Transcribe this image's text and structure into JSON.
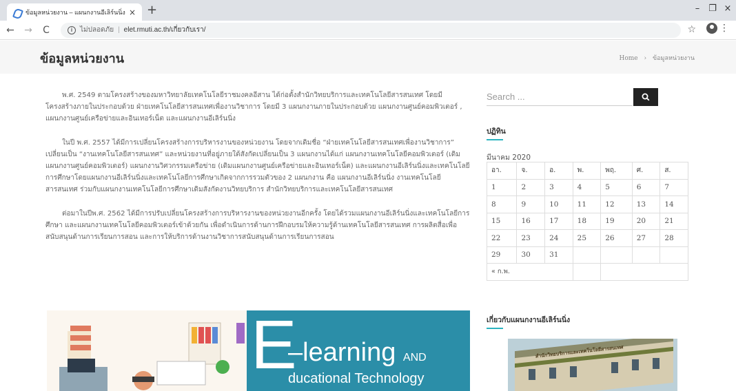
{
  "browser": {
    "tab_title": "ข้อมูลหน่วยงาน – แผนกงานอีเลิร์นนิ่ง",
    "tab_close": "×",
    "new_tab": "+",
    "security_label": "ไม่ปลอดภัย",
    "url": "elet.rmuti.ac.th/เกี่ยวกับเรา/",
    "window_controls": [
      "–",
      "❐",
      "×"
    ]
  },
  "header": {
    "title": "ข้อมูลหน่วยงาน",
    "breadcrumb_home": "Home",
    "breadcrumb_sep": "›",
    "breadcrumb_current": "ข้อมูลหน่วยงาน"
  },
  "main": {
    "paragraphs": [
      "พ.ศ. 2549 ตามโครงสร้างของมหาวิทยาลัยเทคโนโลยีราชมงคลอีสาน ได้ก่อตั้งสำนักวิทยบริการและเทคโนโลยีสารสนเทศ โดยมีโครงสร้างภายในประกอบด้วย ฝ่ายเทคโนโลยีสารสนเทศเพื่องานวิชาการ โดยมี 3 แผนกงานภายในประกอบด้วย แผนกงานศูนย์คอมพิวเตอร์ , แผนกงานศูนย์เครือข่ายและอินเทอร์เน็ต และแผนกงานอีเลิร์นนิ่ง",
      "ในปี พ.ศ. 2557 ได้มีการเปลี่ยนโครงสร้างการบริหารงานของหน่วยงาน โดยจากเดิมชื่อ “ฝ่ายเทคโนโลยีสารสนเทศเพื่องานวิชาการ” เปลี่ยนเป็น “งานเทคโนโลยีสารสนเทศ” และหน่วยงานที่อยู่ภายใต้สังกัดเปลี่ยนเป็น 3 แผนกงานได้แก่ แผนกงานเทคโนโลยีคอมพิวเตอร์ (เดิมแผนกงานศูนย์คอมพิวเตอร์) แผนกงานวิศวกรรมเครือข่าย (เดิมแผนกงานศูนย์เครือข่ายและอินเทอร์เน็ต) และแผนกงานอีเลิร์นนิ่งและเทคโนโลยีการศึกษาโดยแผนกงานอีเลิร์นนิ่งและเทคโนโลยีการศึกษาเกิดจากการรวมตัวของ 2 แผนกงาน คือ แผนกงานอีเลิร์นนิ่ง งานเทคโนโลยีสารสนเทศ ร่วมกับแผนกงานเทคโนโลยีการศึกษาเดิมสังกัดงานวิทยบริการ สำนักวิทยบริการและเทคโนโลยีสารสนเทศ",
      "ต่อมาในปีพ.ศ. 2562 ได้มีการปรับเปลี่ยนโครงสร้างการบริหารงานของหน่วยงานอีกครั้ง โดยได้รวมแผนกงานอีเลิร์นนิ่งและเทคโนโลยีการศึกษา และแผนกงานเทคโนโลยีคอมพิวเตอร์เข้าด้วยกัน เพื่อดำเนินการด้านการฝึกอบรมให้ความรู้ด้านเทคโนโลยีสารสนเทศ การผลิตสื่อเพื่อสนับสนุนด้านการเรียนการสอน และการให้บริการด้านงานวิชาการสนับสนุนด้านการเรียนการสอน"
    ],
    "banner": {
      "big_letter": "E",
      "line1": "–learning",
      "line1_suffix": "AND",
      "line2": "ducational Technology"
    }
  },
  "sidebar": {
    "search_placeholder": "Search ...",
    "calendar_title": "ปฏิทิน",
    "calendar_caption": "มีนาคม 2020",
    "weekdays": [
      "อา.",
      "จ.",
      "อ.",
      "พ.",
      "พฤ.",
      "ศ.",
      "ส."
    ],
    "weeks": [
      [
        "1",
        "2",
        "3",
        "4",
        "5",
        "6",
        "7"
      ],
      [
        "8",
        "9",
        "10",
        "11",
        "12",
        "13",
        "14"
      ],
      [
        "15",
        "16",
        "17",
        "18",
        "19",
        "20",
        "21"
      ],
      [
        "22",
        "23",
        "24",
        "25",
        "26",
        "27",
        "28"
      ],
      [
        "29",
        "30",
        "31",
        "",
        "",
        "",
        ""
      ]
    ],
    "prev_month": "« ก.พ.",
    "about_title": "เกี่ยวกับแผนกงานอีเลิร์นนิ่ง",
    "about_sign": "สำนักวิทยบริการและเทคโนโลยีสารสนเทศ"
  }
}
